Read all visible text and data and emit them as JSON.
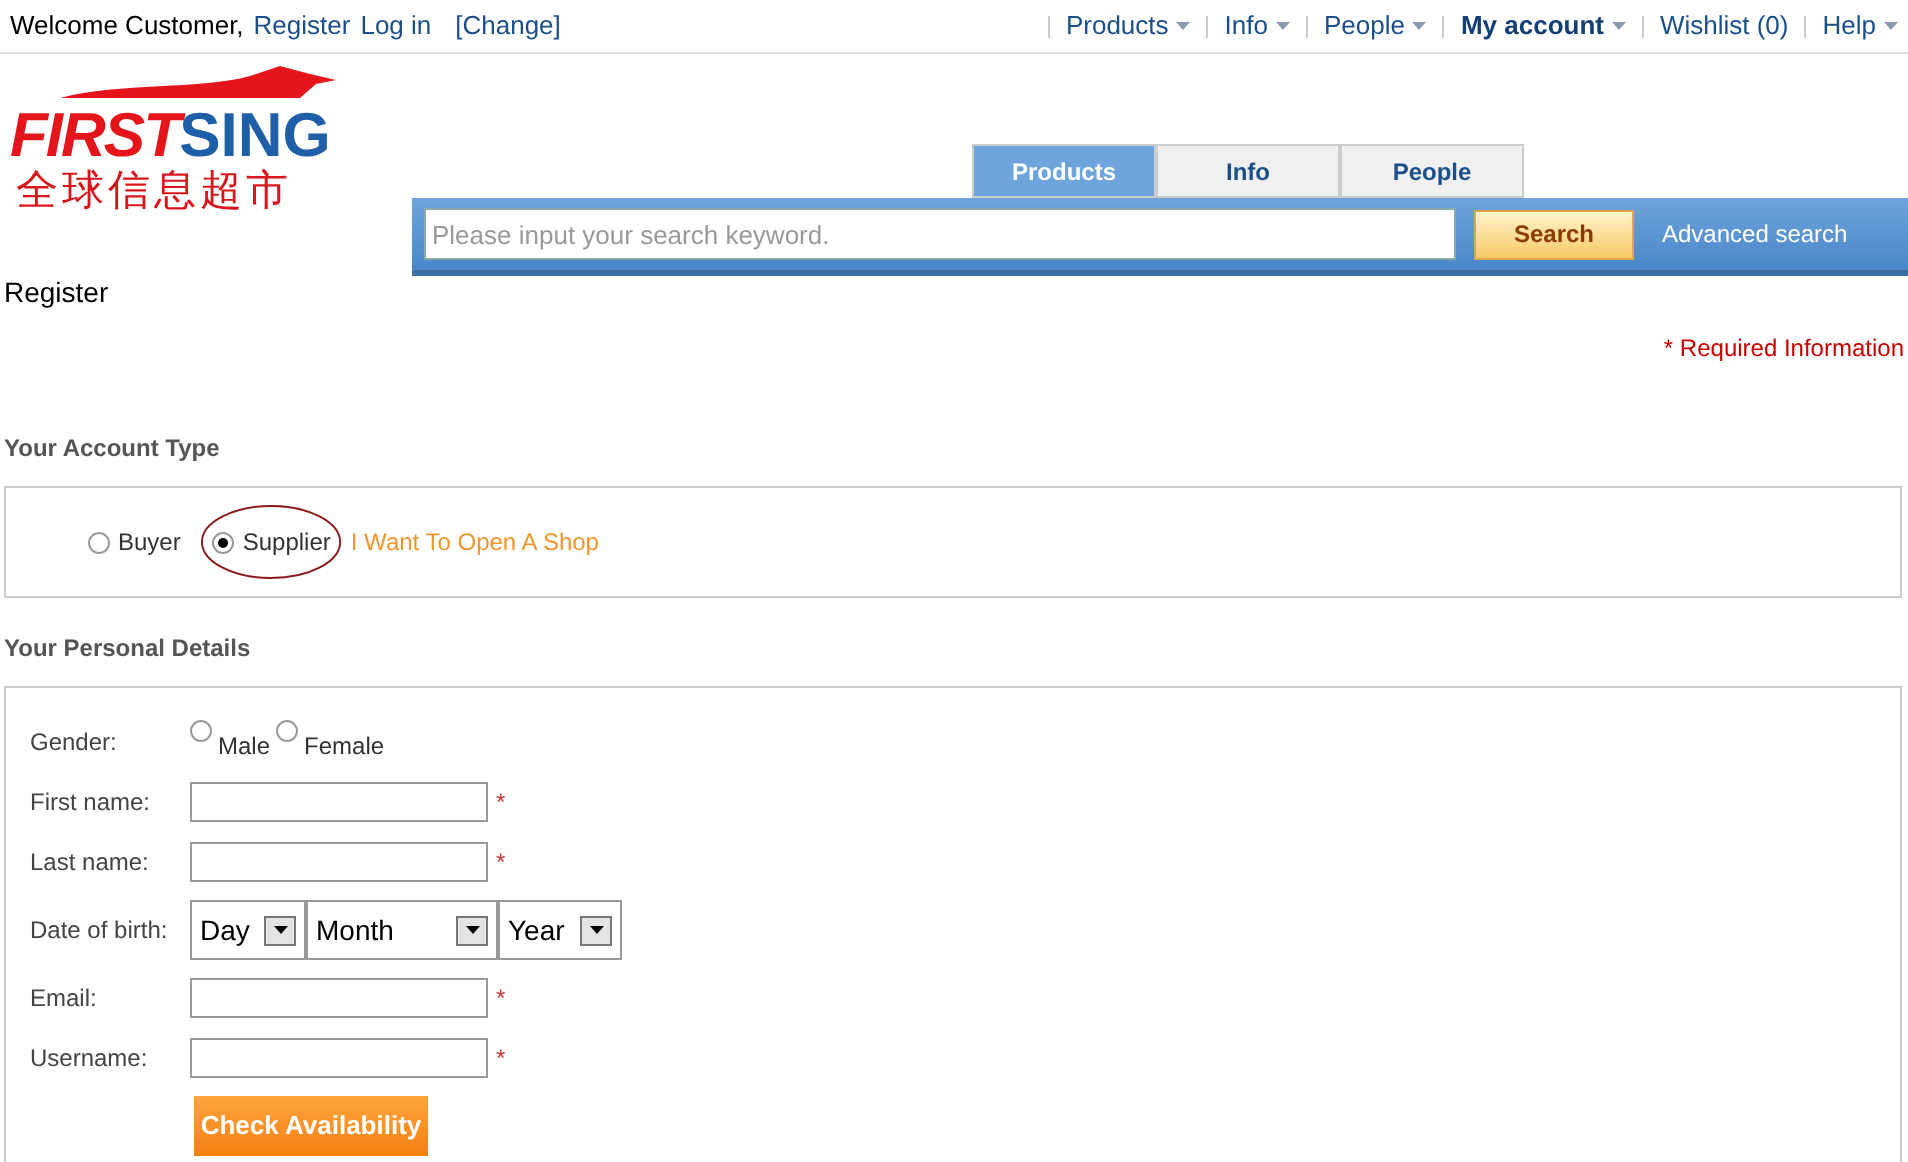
{
  "top_bar": {
    "welcome": "Welcome Customer,",
    "links": [
      "Register",
      "Log in"
    ],
    "change": "[Change]"
  },
  "nav": [
    {
      "label": "Products",
      "dropdown": true,
      "bold": false
    },
    {
      "label": "Info",
      "dropdown": true,
      "bold": false
    },
    {
      "label": "People",
      "dropdown": true,
      "bold": false
    },
    {
      "label": "My account",
      "dropdown": true,
      "bold": true
    },
    {
      "label": "Wishlist (0)",
      "dropdown": false,
      "bold": false
    },
    {
      "label": "Help",
      "dropdown": true,
      "bold": false
    }
  ],
  "logo": {
    "word_1": "FIRST",
    "word_2": "SING",
    "tagline": "全球信息超市"
  },
  "search_tabs": [
    {
      "label": "Products",
      "selected": true
    },
    {
      "label": "Info",
      "selected": false
    },
    {
      "label": "People",
      "selected": false
    }
  ],
  "search": {
    "placeholder": "Please input your search keyword.",
    "button": "Search",
    "advanced": "Advanced search"
  },
  "page_title": "Register",
  "required_note": "* Required Information",
  "account_type": {
    "heading": "Your Account Type",
    "options": [
      {
        "label": "Buyer",
        "selected": false,
        "circled": false
      },
      {
        "label": "Supplier",
        "selected": true,
        "circled": true
      }
    ],
    "shop_link": "I Want To Open A Shop"
  },
  "personal": {
    "heading": "Your Personal Details",
    "rows": [
      {
        "kind": "radio",
        "label": "Gender:",
        "options": [
          {
            "label": "Male",
            "selected": false
          },
          {
            "label": "Female",
            "selected": false
          }
        ]
      },
      {
        "kind": "text",
        "label": "First name:",
        "required": "*"
      },
      {
        "kind": "text",
        "label": "Last name:",
        "required": "*"
      },
      {
        "kind": "date",
        "label": "Date of birth:",
        "selects": [
          "Day",
          "Month",
          "Year"
        ]
      },
      {
        "kind": "text",
        "label": "Email:",
        "required": "*"
      },
      {
        "kind": "text",
        "label": "Username:",
        "required": "*"
      }
    ],
    "button": "Check Availability"
  }
}
